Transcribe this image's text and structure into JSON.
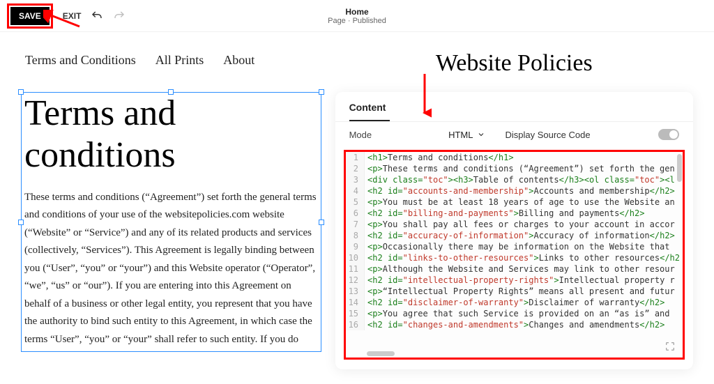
{
  "topbar": {
    "save": "SAVE",
    "exit": "EXIT",
    "page_title": "Home",
    "page_sub": "Page · Published"
  },
  "nav": {
    "items": [
      "Terms and Conditions",
      "All Prints",
      "About"
    ]
  },
  "document": {
    "heading": "Terms and conditions",
    "body": "These terms and conditions (“Agreement”) set forth the general terms and conditions of your use of the websitepolicies.com website (“Website” or “Service”) and any of its related products and services (collectively, “Services”). This Agreement is legally binding between you (“User”, “you” or “your”) and this Website operator (“Operator”, “we”, “us” or “our”). If you are entering into this Agreement on behalf of a business or other legal entity, you represent that you have the authority to bind such entity to this Agreement, in which case the terms “User”, “you” or “your” shall refer to such entity. If you do"
  },
  "right": {
    "title": "Website Policies"
  },
  "panel": {
    "tab": "Content",
    "mode_label": "Mode",
    "mode_value": "HTML",
    "display_source": "Display Source Code"
  },
  "code": {
    "lines": [
      {
        "n": 1,
        "pre": "<h1>",
        "txt": "Terms and conditions",
        "post": "</h1>"
      },
      {
        "n": 2,
        "pre": "<p>",
        "txt": "These terms and conditions (“Agreement”) set forth the gen",
        "post": ""
      },
      {
        "n": 3,
        "raw": "toc"
      },
      {
        "n": 4,
        "tag": "h2",
        "id": "accounts-and-membership",
        "txt": "Accounts and membership",
        "close": "</h2>"
      },
      {
        "n": 5,
        "pre": "<p>",
        "txt": "You must be at least 18 years of age to use the Website an",
        "post": ""
      },
      {
        "n": 6,
        "tag": "h2",
        "id": "billing-and-payments",
        "txt": "Billing and payments",
        "close": "</h2>"
      },
      {
        "n": 7,
        "pre": "<p>",
        "txt": "You shall pay all fees or charges to your account in accor",
        "post": ""
      },
      {
        "n": 8,
        "tag": "h2",
        "id": "accuracy-of-information",
        "txt": "Accuracy of information",
        "close": "</h2>"
      },
      {
        "n": 9,
        "pre": "<p>",
        "txt": "Occasionally there may be information on the Website that ",
        "post": ""
      },
      {
        "n": 10,
        "tag": "h2",
        "id": "links-to-other-resources",
        "txt": "Links to other resources",
        "close": "</h2"
      },
      {
        "n": 11,
        "pre": "<p>",
        "txt": "Although the Website and Services may link to other resour",
        "post": ""
      },
      {
        "n": 12,
        "tag": "h2",
        "id": "intellectual-property-rights",
        "txt": "Intellectual property r",
        "close": ""
      },
      {
        "n": 13,
        "pre": "<p>",
        "txt": "“Intellectual Property Rights” means all present and futur",
        "post": ""
      },
      {
        "n": 14,
        "tag": "h2",
        "id": "disclaimer-of-warranty",
        "txt": "Disclaimer of warranty",
        "close": "</h2>"
      },
      {
        "n": 15,
        "pre": "<p>",
        "txt": "You agree that such Service is provided on an “as is” and ",
        "post": ""
      },
      {
        "n": 16,
        "tag": "h2",
        "id": "changes-and-amendments",
        "txt": "Changes and amendments",
        "close": "</h2>"
      }
    ]
  }
}
